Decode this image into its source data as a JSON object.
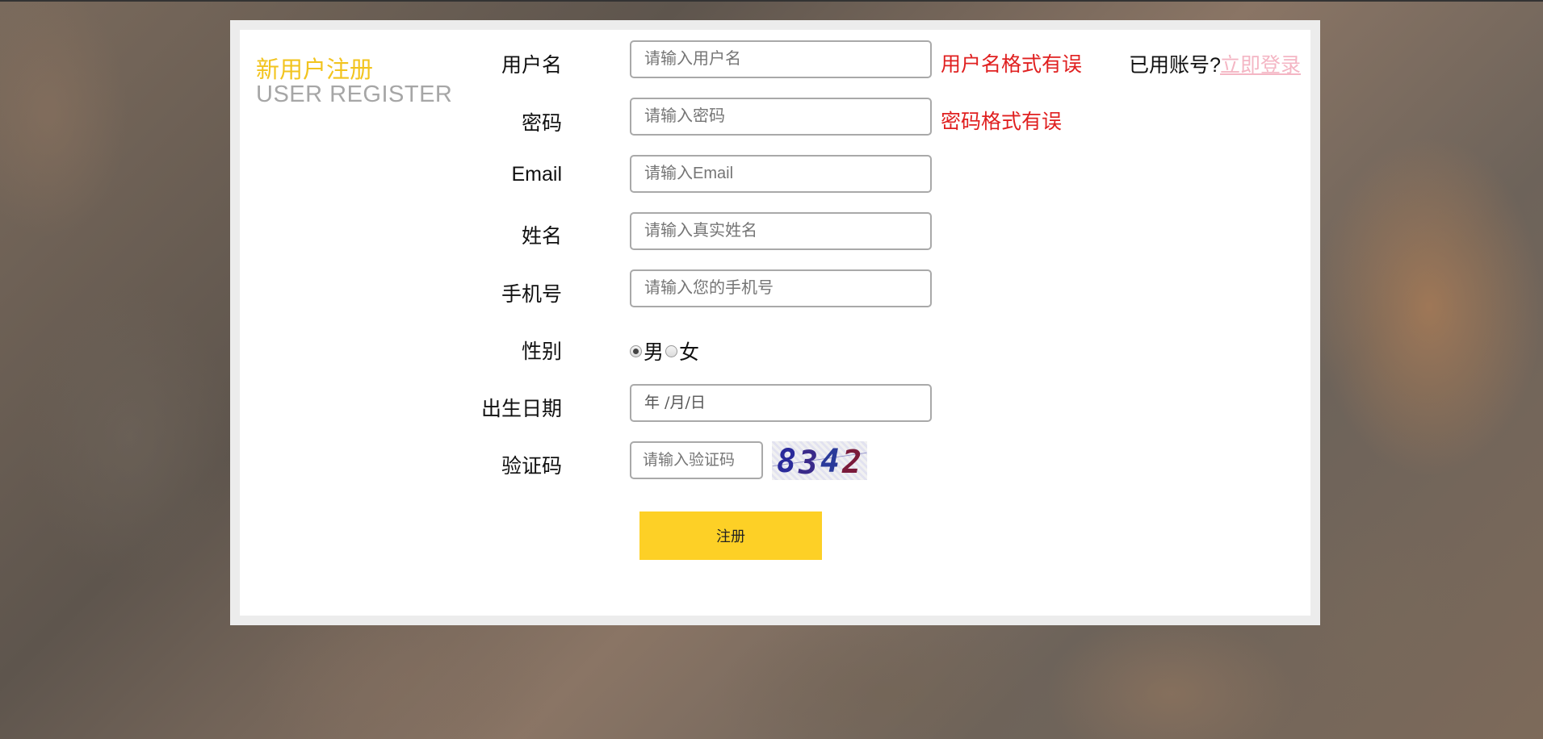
{
  "header": {
    "title_cn": "新用户注册",
    "title_en": "USER REGISTER",
    "login_hint": "已用账号?",
    "login_link": "立即登录"
  },
  "form": {
    "username": {
      "label": "用户名",
      "placeholder": "请输入用户名",
      "error": "用户名格式有误"
    },
    "password": {
      "label": "密码",
      "placeholder": "请输入密码",
      "error": "密码格式有误"
    },
    "email": {
      "label": "Email",
      "placeholder": "请输入Email"
    },
    "realname": {
      "label": "姓名",
      "placeholder": "请输入真实姓名"
    },
    "phone": {
      "label": "手机号",
      "placeholder": "请输入您的手机号"
    },
    "gender": {
      "label": "性别",
      "options": [
        "男",
        "女"
      ],
      "selected": "男"
    },
    "birthday": {
      "label": "出生日期",
      "display": "年 /月/日"
    },
    "captcha": {
      "label": "验证码",
      "placeholder": "请输入验证码",
      "code": [
        "8",
        "3",
        "4",
        "2"
      ]
    },
    "submit_label": "注册"
  },
  "colors": {
    "accent_yellow": "#f2c41f",
    "button_yellow": "#fdd026",
    "error_red": "#e02020",
    "link_pink": "#f4b6c4",
    "subtitle_gray": "#a6a6a6"
  }
}
